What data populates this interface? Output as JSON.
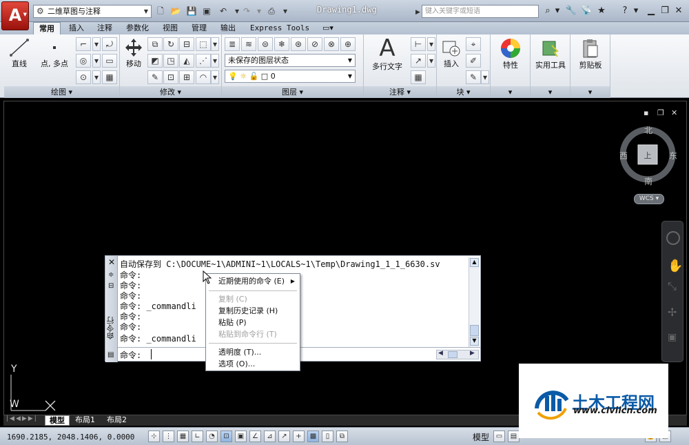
{
  "titlebar": {
    "app_logo": "A",
    "workspace": "二维草图与注释",
    "document_title": "Drawing1.dwg",
    "search_placeholder": "键入关键字或短语"
  },
  "tabs": [
    "常用",
    "插入",
    "注释",
    "参数化",
    "视图",
    "管理",
    "输出",
    "Express Tools"
  ],
  "ribbon": {
    "draw": {
      "title": "绘图",
      "line": "直线",
      "point": "点, 多点"
    },
    "modify": {
      "title": "修改",
      "move": "移动"
    },
    "layers": {
      "title": "图层",
      "layer_state": "未保存的图层状态",
      "current_layer": "0"
    },
    "annotation": {
      "title": "注释",
      "mtext": "多行文字",
      "mtext_glyph": "A"
    },
    "block": {
      "title": "块",
      "insert": "插入"
    },
    "properties": {
      "label": "特性"
    },
    "utilities": {
      "label": "实用工具"
    },
    "clipboard": {
      "label": "剪贴板"
    }
  },
  "viewport": {
    "compass": {
      "north": "北",
      "south": "南",
      "east": "东",
      "west": "西"
    },
    "wcs": "WCS"
  },
  "command_window": {
    "side_label": "命令行",
    "history": [
      "自动保存到 C:\\DOCUME~1\\ADMINI~1\\LOCALS~1\\Temp\\Drawing1_1_1_6630.sv",
      "命令:",
      "命令:",
      "命令:",
      "命令: _commandli",
      "命令:",
      "命令:",
      "命令: _commandli"
    ],
    "prompt": "命令:"
  },
  "context_menu": {
    "recent": "近期使用的命令 (E)",
    "copy": "复制 (C)",
    "copy_history": "复制历史记录 (H)",
    "paste": "粘贴 (P)",
    "paste_to_cmd": "粘贴到命令行 (T)",
    "transparency": "透明度 (T)...",
    "options": "选项 (O)..."
  },
  "ucs": {
    "y": "Y",
    "w": "W"
  },
  "layout_tabs": [
    "模型",
    "布局1",
    "布局2"
  ],
  "statusbar": {
    "coords": "1690.2185, 2048.1406, 0.0000",
    "model_label": "模型"
  },
  "watermark": {
    "name": "土木工程网",
    "url": "www.civilcn.com"
  },
  "colors": {
    "canvas": "#000000",
    "ribbon_bg": "#eef1f5",
    "logo_red": "#c4251b",
    "watermark_blue": "#0a5aa7"
  }
}
